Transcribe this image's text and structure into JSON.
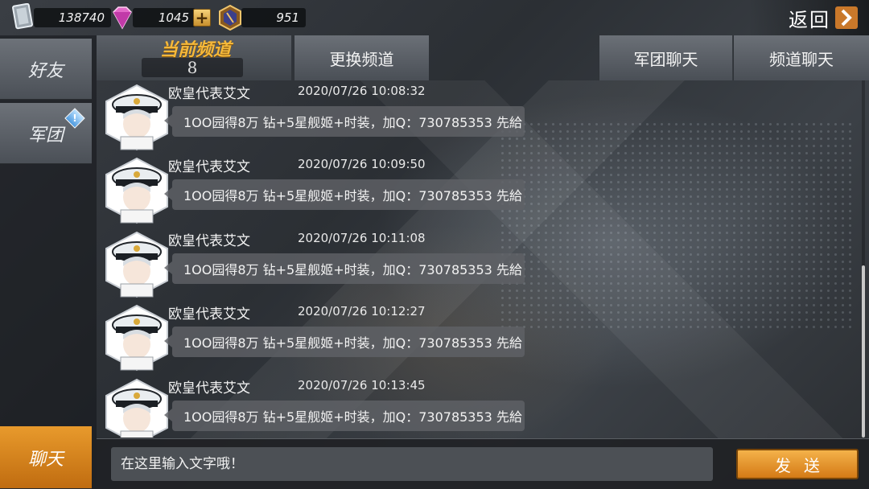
{
  "resources": [
    {
      "icon": "silver-card-icon",
      "value": "138740"
    },
    {
      "icon": "pink-diamond-icon",
      "value": "1045"
    },
    {
      "icon": "gold-medal-icon",
      "value": "951"
    }
  ],
  "back": {
    "label": "返回"
  },
  "nav": [
    {
      "label": "好友",
      "active": false
    },
    {
      "label": "军团",
      "active": false,
      "badge": "!"
    },
    {
      "label": "聊天",
      "active": true
    }
  ],
  "channel": {
    "title": "当前频道",
    "number": "8"
  },
  "tabs": {
    "change_channel": "更换频道",
    "legion_chat": "军团聊天",
    "channel_chat": "频道聊天"
  },
  "messages": [
    {
      "name": "欧皇代表艾文",
      "time": "2020/07/26 10:08:32",
      "text": "1OO园得8万 钻+5星舰姬+时装，加Q：730785353 先給"
    },
    {
      "name": "欧皇代表艾文",
      "time": "2020/07/26 10:09:50",
      "text": "1OO园得8万 钻+5星舰姬+时装，加Q：730785353 先給"
    },
    {
      "name": "欧皇代表艾文",
      "time": "2020/07/26 10:11:08",
      "text": "1OO园得8万 钻+5星舰姬+时装，加Q：730785353 先給"
    },
    {
      "name": "欧皇代表艾文",
      "time": "2020/07/26 10:12:27",
      "text": "1OO园得8万 钻+5星舰姬+时装，加Q：730785353 先給"
    },
    {
      "name": "欧皇代表艾文",
      "time": "2020/07/26 10:13:45",
      "text": "1OO园得8万 钻+5星舰姬+时装，加Q：730785353 先給"
    }
  ],
  "input": {
    "placeholder": "在这里输入文字哦！"
  },
  "send": {
    "label": "发送"
  },
  "colors": {
    "accent": "#e89a2c",
    "channel_title": "#f5b83a"
  }
}
